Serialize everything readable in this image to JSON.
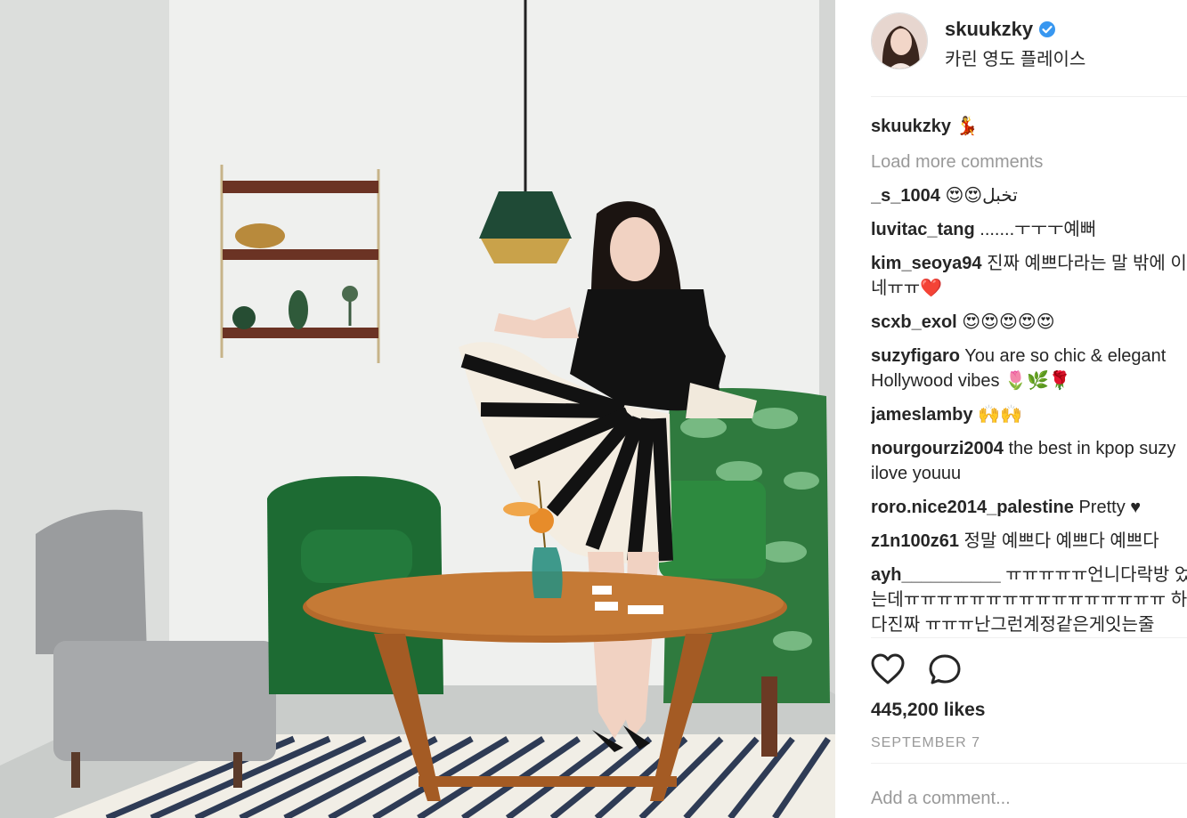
{
  "post": {
    "username": "skuukzky",
    "location": "카린 영도 플레이스",
    "caption_user": "skuukzky",
    "caption_text": "💃",
    "load_more": "Load more comments",
    "likes": "445,200 likes",
    "date": "SEPTEMBER 7",
    "add_comment_placeholder": "Add a comment..."
  },
  "comments": [
    {
      "user": "_s_1004",
      "text": "😍😍تخبل"
    },
    {
      "user": "luvitac_tang",
      "text": ".......ㅜㅜㅜ예뻐"
    },
    {
      "user": "kim_seoya94",
      "text": "진짜 예쁘다라는 말 밖에 이 없네ㅠㅠ❤️"
    },
    {
      "user": "scxb_exol",
      "text": "😍😍😍😍😍"
    },
    {
      "user": "suzyfigaro",
      "text": "You are so chic & elegant Hollywood vibes 🌷🌿🌹"
    },
    {
      "user": "jameslamby",
      "text": "🙌🙌"
    },
    {
      "user": "nourgourzi2004",
      "text": "the best in kpop suzy ilove youuu"
    },
    {
      "user": "roro.nice2014_palestine",
      "text": "Pretty ♥"
    },
    {
      "user": "z1n100z61",
      "text": "정말 예쁘다 예쁘다 예쁘다"
    },
    {
      "user": "ayh__________",
      "text": "ㅠㅠㅠㅠㅠ언니다락방 었는데ㅠㅠㅠㅠㅠㅠㅠㅠㅠㅠㅠㅠㅠㅠㅠㅠ 하다진짜 ㅠㅠㅠ난그런계정같은게잇는줄"
    }
  ],
  "icons": {
    "verified": "verified-badge-icon",
    "like": "heart-outline-icon",
    "comment": "speech-bubble-icon"
  },
  "colors": {
    "verified_blue": "#3897f0",
    "muted_text": "#999999",
    "divider": "#efefef"
  }
}
